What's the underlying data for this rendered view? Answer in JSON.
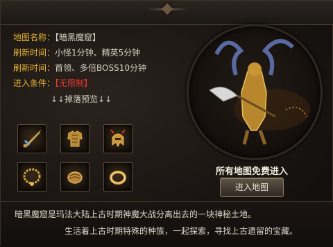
{
  "map_info": {
    "name_label": "地图名称：",
    "name_value": "【暗黑魔窟】",
    "refresh1_label": "刷新时间：",
    "refresh1_value": "小怪1分钟、精英5分钟",
    "refresh2_label": "刷新时间：",
    "refresh2_value": "首领、多倍BOSS10分钟",
    "condition_label": "进入条件：",
    "condition_value": "【无限制】"
  },
  "drops": {
    "title": "↓↓掉落预览↓↓",
    "items": [
      {
        "icon": "sword-icon"
      },
      {
        "icon": "armor-icon"
      },
      {
        "icon": "helmet-icon"
      },
      {
        "icon": "necklace-icon"
      },
      {
        "icon": "bracer-icon"
      },
      {
        "icon": "ring-icon"
      }
    ]
  },
  "boss": {
    "free_text": "所有地图免费进入",
    "enter_button": "进入地图"
  },
  "description": {
    "line1": "暗黑魔窟是玛法大陆上古时期神魔大战分离出去的一块神秘土地。",
    "line2": "生活着上古时期特殊的种族，一起探索，寻找上古遗留的宝藏。"
  },
  "colors": {
    "label": "#e7b42b",
    "highlight": "#e23a2a",
    "text": "#d8d0c2"
  }
}
